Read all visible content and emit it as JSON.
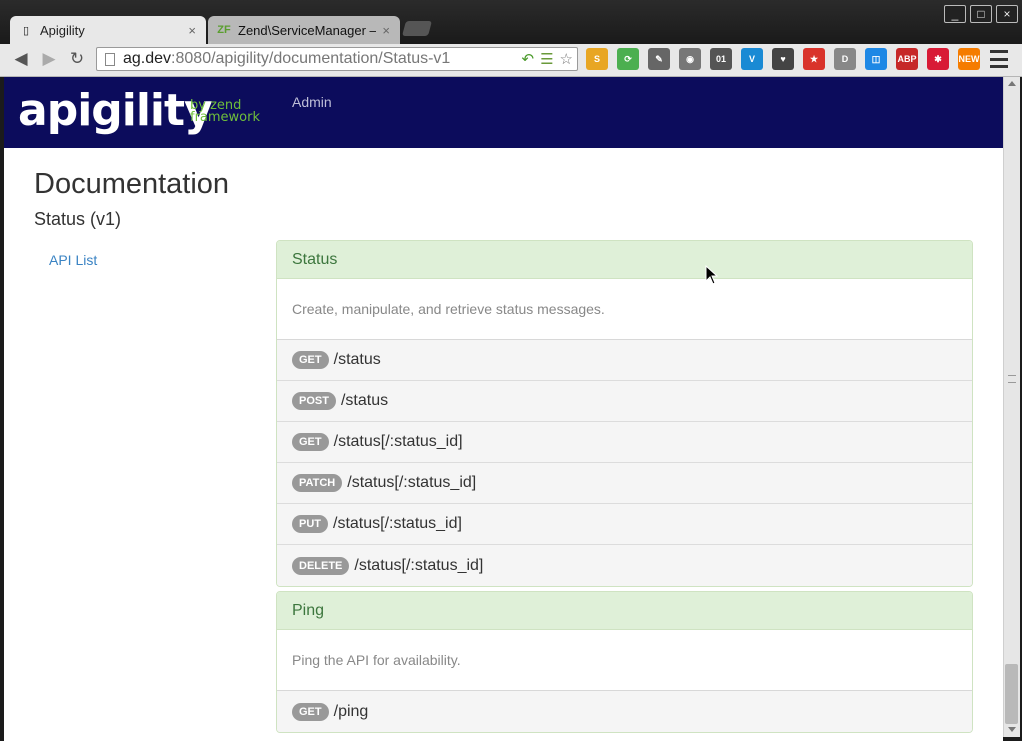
{
  "browser": {
    "tabs": [
      {
        "label": "Apigility",
        "active": true
      },
      {
        "label": "Zend\\ServiceManager —",
        "active": false
      }
    ],
    "url": {
      "host": "ag.dev",
      "path": ":8080/apigility/documentation/Status-v1"
    },
    "window_buttons": [
      "_",
      "□",
      "×"
    ],
    "extensions": [
      {
        "name": "s-extension-icon",
        "label": "S",
        "color": "#e8a623"
      },
      {
        "name": "refresh-extension-icon",
        "label": "⟳",
        "color": "#4caf50"
      },
      {
        "name": "pen-extension-icon",
        "label": "✎",
        "color": "#666666"
      },
      {
        "name": "ghost-extension-icon",
        "label": "◉",
        "color": "#777777"
      },
      {
        "name": "binary-extension-icon",
        "label": "01",
        "color": "#555555"
      },
      {
        "name": "v-extension-icon",
        "label": "V",
        "color": "#1a8ad4"
      },
      {
        "name": "pocket-extension-icon",
        "label": "♥",
        "color": "#444444"
      },
      {
        "name": "bookmark-extension-icon",
        "label": "★",
        "color": "#d9332b"
      },
      {
        "name": "d-extension-icon",
        "label": "D",
        "color": "#888888"
      },
      {
        "name": "window-extension-icon",
        "label": "◫",
        "color": "#1e88e5"
      },
      {
        "name": "adblock-extension-icon",
        "label": "ABP",
        "color": "#c62828"
      },
      {
        "name": "asterisk-extension-icon",
        "label": "✱",
        "color": "#d81b36"
      },
      {
        "name": "new-extension-icon",
        "label": "NEW",
        "color": "#f57c00"
      }
    ]
  },
  "navbar": {
    "logo": "apigility",
    "logo_sub_1": "by zend",
    "logo_sub_2": "framework",
    "admin_label": "Admin"
  },
  "page": {
    "title": "Documentation",
    "subtitle": "Status (v1)",
    "sidebar_link": "API List"
  },
  "services": [
    {
      "name": "Status",
      "description": "Create, manipulate, and retrieve status messages.",
      "operations": [
        {
          "method": "GET",
          "path": "/status"
        },
        {
          "method": "POST",
          "path": "/status"
        },
        {
          "method": "GET",
          "path": "/status[/:status_id]"
        },
        {
          "method": "PATCH",
          "path": "/status[/:status_id]"
        },
        {
          "method": "PUT",
          "path": "/status[/:status_id]"
        },
        {
          "method": "DELETE",
          "path": "/status[/:status_id]"
        }
      ]
    },
    {
      "name": "Ping",
      "description": "Ping the API for availability.",
      "operations": [
        {
          "method": "GET",
          "path": "/ping"
        }
      ]
    }
  ]
}
